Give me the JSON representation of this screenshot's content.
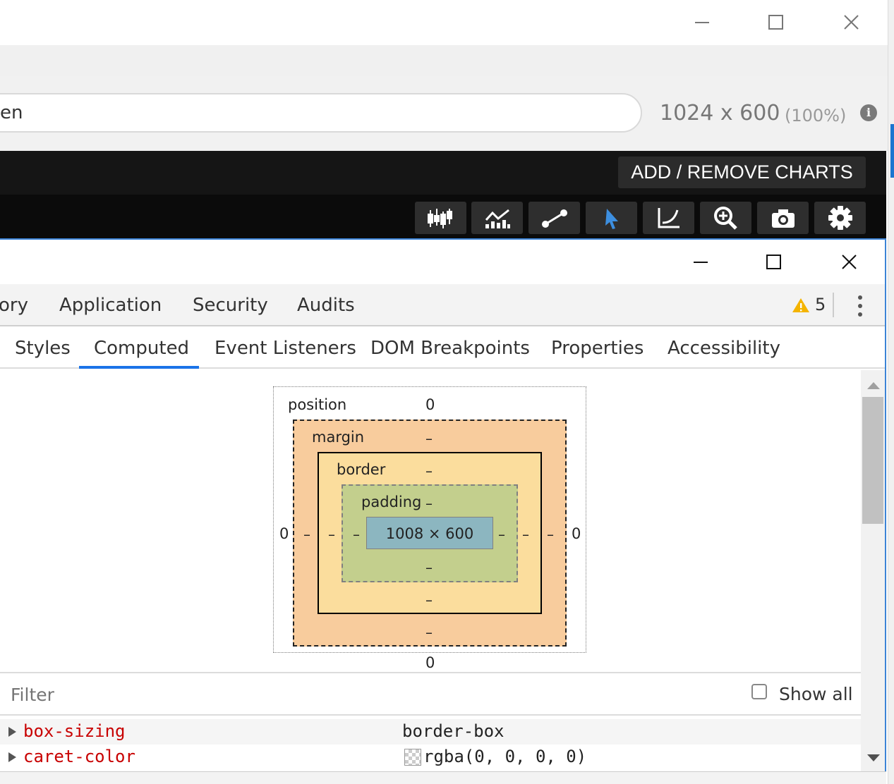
{
  "browser": {
    "url_partial": "en",
    "viewport_size": "1024 x 600",
    "viewport_zoom": "(100%)"
  },
  "app": {
    "add_remove_charts": "ADD / REMOVE CHARTS",
    "toolbar_icons": [
      "studies-icon",
      "chart-type-icon",
      "drawing-line-icon",
      "cursor-icon",
      "curve-icon",
      "zoom-in-icon",
      "camera-icon",
      "settings-gear-icon"
    ]
  },
  "devtools": {
    "tabs": [
      "ory",
      "Application",
      "Security",
      "Audits"
    ],
    "warning_count": "5",
    "subtabs": [
      "Styles",
      "Computed",
      "Event Listeners",
      "DOM Breakpoints",
      "Properties",
      "Accessibility"
    ],
    "active_subtab": "Computed",
    "box_model": {
      "position_label": "position",
      "position_top": "0",
      "position_bottom": "0",
      "position_left": "0",
      "position_right": "0",
      "margin_label": "margin",
      "margin_top": "–",
      "margin_bottom": "–",
      "margin_left": "–",
      "margin_right": "–",
      "border_label": "border",
      "border_top": "–",
      "border_bottom": "–",
      "border_left": "–",
      "border_right": "–",
      "padding_label": "padding",
      "padding_top": "–",
      "padding_bottom": "–",
      "padding_left": "–",
      "padding_right": "–",
      "content": "1008 × 600"
    },
    "filter_placeholder": "Filter",
    "show_all_label": "Show all",
    "properties": [
      {
        "name": "box-sizing",
        "value": "border-box"
      },
      {
        "name": "caret-color",
        "value": "rgba(0, 0, 0, 0)"
      }
    ]
  }
}
